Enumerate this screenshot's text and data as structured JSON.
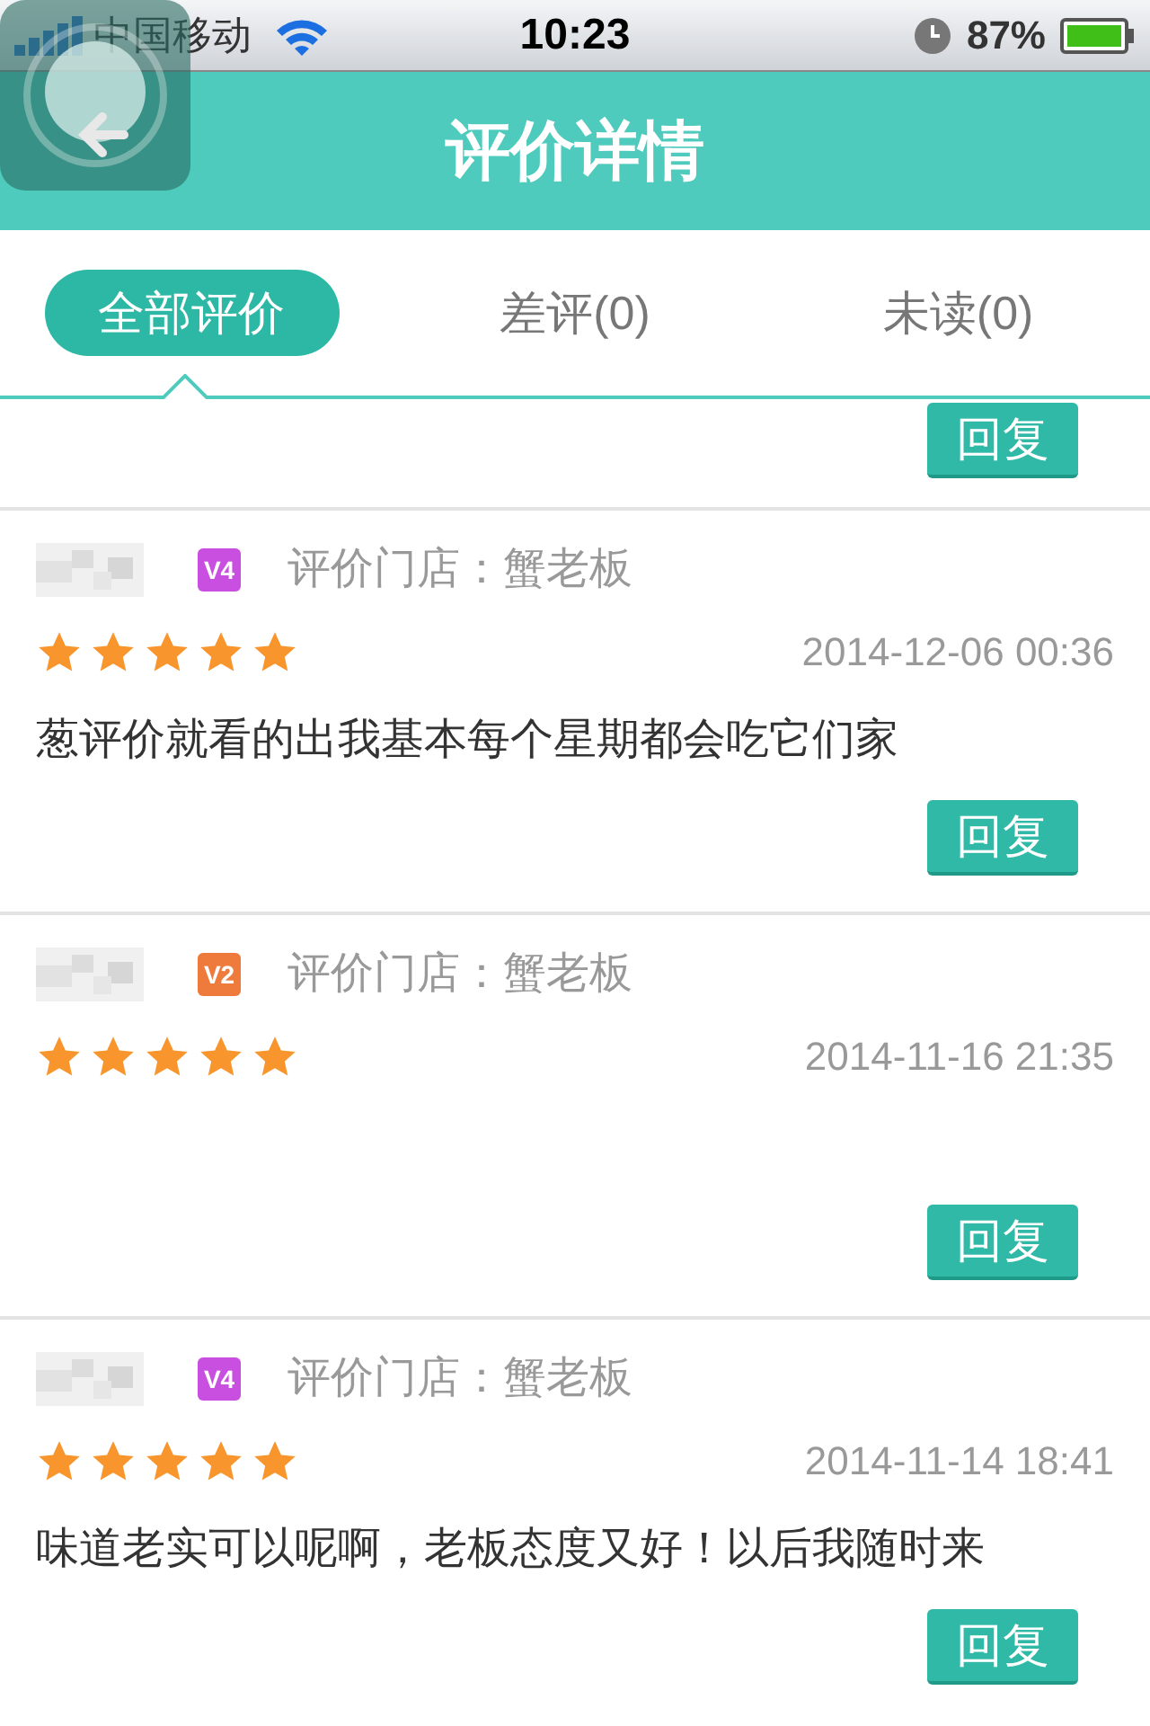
{
  "status_bar": {
    "carrier": "中国移动",
    "time": "10:23",
    "battery": "87%"
  },
  "header": {
    "title": "评价详情"
  },
  "tabs": [
    {
      "label": "全部评价",
      "selected": true
    },
    {
      "label": "差评(0)",
      "selected": false
    },
    {
      "label": "未读(0)",
      "selected": false
    }
  ],
  "top_reply_button": "回复",
  "reviews": [
    {
      "badge": "V4",
      "color": "#c94fe0",
      "store": "评价门店：蟹老板",
      "stars": 5,
      "time": "2014-12-06 00:36",
      "text": "葱评价就看的出我基本每个星期都会吃它们家",
      "reply": "回复"
    },
    {
      "badge": "V2",
      "color": "#ee7a3c",
      "store": "评价门店：蟹老板",
      "stars": 5,
      "time": "2014-11-16 21:35",
      "reply": "回复"
    },
    {
      "badge": "V4",
      "color": "#c94fe0",
      "store": "评价门店：蟹老板",
      "stars": 5,
      "time": "2014-11-14 18:41",
      "text": "味道老实可以呢啊，老板态度又好！以后我随时来",
      "reply": "回复"
    }
  ]
}
